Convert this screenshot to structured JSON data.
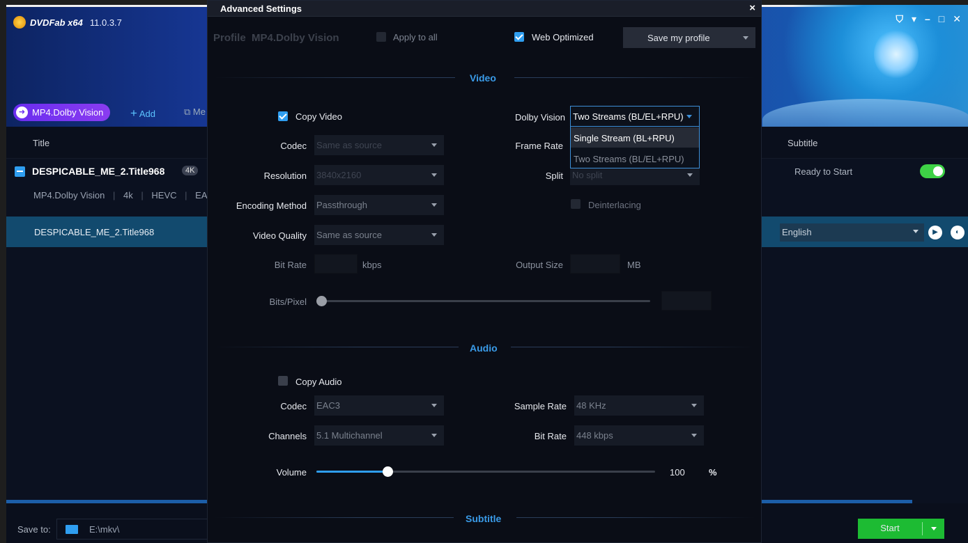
{
  "app": {
    "logo_text": "DVDFab x64",
    "version": "11.0.3.7",
    "window_controls": {
      "pin": "▾",
      "minimize": "–",
      "maximize": "□",
      "close": "✕",
      "shirt": "👕"
    },
    "profile_pill": "MP4.Dolby Vision",
    "add_label": "Add",
    "merge_label": "Me",
    "columns": {
      "title": "Title",
      "subtitle": "Subtitle"
    },
    "title_row": {
      "name": "DESPICABLE_ME_2.Title968",
      "badge": "4K",
      "meta": [
        "MP4.Dolby Vision",
        "4k",
        "HEVC",
        "EA"
      ],
      "status": "Ready to Start"
    },
    "track_row": {
      "name": "DESPICABLE_ME_2.Title968",
      "subtitle_value": "English"
    },
    "footer": {
      "save_to_label": "Save to:",
      "path": "E:\\mkv\\",
      "start_label": "Start"
    }
  },
  "dialog": {
    "title": "Advanced Settings",
    "close": "×",
    "profile_label": "Profile",
    "profile_name": "MP4.Dolby Vision",
    "apply_all_label": "Apply to all",
    "web_optimized_label": "Web Optimized",
    "save_profile_label": "Save my profile",
    "video": {
      "section": "Video",
      "copy_video_label": "Copy Video",
      "codec_label": "Codec",
      "codec_value": "Same as source",
      "resolution_label": "Resolution",
      "resolution_value": "3840x2160",
      "encoding_label": "Encoding Method",
      "encoding_value": "Passthrough",
      "quality_label": "Video Quality",
      "quality_value": "Same as source",
      "bitrate_label": "Bit Rate",
      "bitrate_unit": "kbps",
      "bits_pixel_label": "Bits/Pixel",
      "dolby_label": "Dolby Vision",
      "dolby_value": "Two Streams (BL/EL+RPU)",
      "dolby_options": [
        "Single Stream (BL+RPU)",
        "Two Streams (BL/EL+RPU)"
      ],
      "frame_rate_label": "Frame Rate",
      "split_label": "Split",
      "split_value": "No split",
      "deinterlacing_label": "Deinterlacing",
      "output_size_label": "Output Size",
      "output_size_unit": "MB"
    },
    "audio": {
      "section": "Audio",
      "copy_audio_label": "Copy Audio",
      "codec_label": "Codec",
      "codec_value": "EAC3",
      "channels_label": "Channels",
      "channels_value": "5.1 Multichannel",
      "sample_rate_label": "Sample Rate",
      "sample_rate_value": "48 KHz",
      "bitrate_label": "Bit Rate",
      "bitrate_value": "448 kbps",
      "volume_label": "Volume",
      "volume_value": "100",
      "volume_unit": "%",
      "volume_fraction": 0.21
    },
    "subtitle": {
      "section": "Subtitle"
    }
  },
  "colors": {
    "accent": "#2f9ef0",
    "section": "#3a9be8",
    "start": "#1dbb33",
    "toggle": "#3ed246",
    "pill": "#7a35f0"
  }
}
